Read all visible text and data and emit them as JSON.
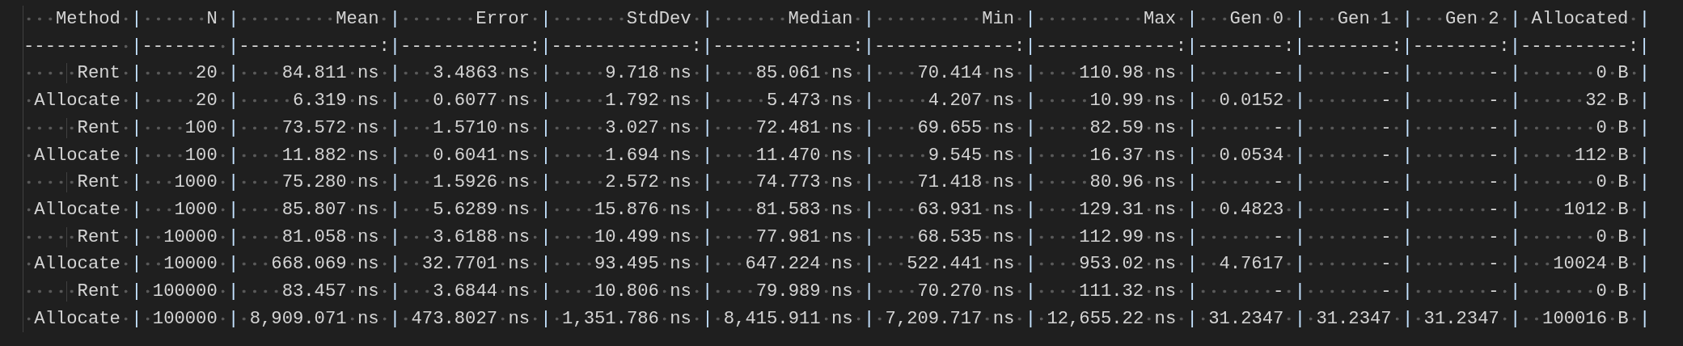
{
  "editor": {
    "lines": [
      "   Method |      N |         Mean |       Error |       StdDev |       Median |          Min |          Max |   Gen 0 |   Gen 1 |   Gen 2 | Allocated |",
      "--------- |------- |-------------:|------------:|-------------:|-------------:|-------------:|-------------:|--------:|--------:|--------:|----------:|",
      "     Rent |     20 |    84.811 ns |   3.4863 ns |     9.718 ns |    85.061 ns |    70.414 ns |    110.98 ns |       - |       - |       - |       0 B |",
      " Allocate |     20 |     6.319 ns |   0.6077 ns |     1.792 ns |     5.473 ns |     4.207 ns |     10.99 ns |  0.0152 |       - |       - |      32 B |",
      "     Rent |    100 |    73.572 ns |   1.5710 ns |     3.027 ns |    72.481 ns |    69.655 ns |     82.59 ns |       - |       - |       - |       0 B |",
      " Allocate |    100 |    11.882 ns |   0.6041 ns |     1.694 ns |    11.470 ns |     9.545 ns |     16.37 ns |  0.0534 |       - |       - |     112 B |",
      "     Rent |   1000 |    75.280 ns |   1.5926 ns |     2.572 ns |    74.773 ns |    71.418 ns |     80.96 ns |       - |       - |       - |       0 B |",
      " Allocate |   1000 |    85.807 ns |   5.6289 ns |    15.876 ns |    81.583 ns |    63.931 ns |    129.31 ns |  0.4823 |       - |       - |    1012 B |",
      "     Rent |  10000 |    81.058 ns |   3.6188 ns |    10.499 ns |    77.981 ns |    68.535 ns |    112.99 ns |       - |       - |       - |       0 B |",
      " Allocate |  10000 |   668.069 ns |  32.7701 ns |    93.495 ns |   647.224 ns |   522.441 ns |    953.02 ns |  4.7617 |       - |       - |   10024 B |",
      "     Rent | 100000 |    83.457 ns |   3.6844 ns |    10.806 ns |    79.989 ns |    70.270 ns |    111.32 ns |       - |       - |       - |       0 B |",
      " Allocate | 100000 | 8,909.071 ns | 473.8027 ns | 1,351.786 ns | 8,415.911 ns | 7,209.717 ns | 12,655.22 ns | 31.2347 | 31.2347 | 31.2347 |  100016 B |"
    ]
  }
}
